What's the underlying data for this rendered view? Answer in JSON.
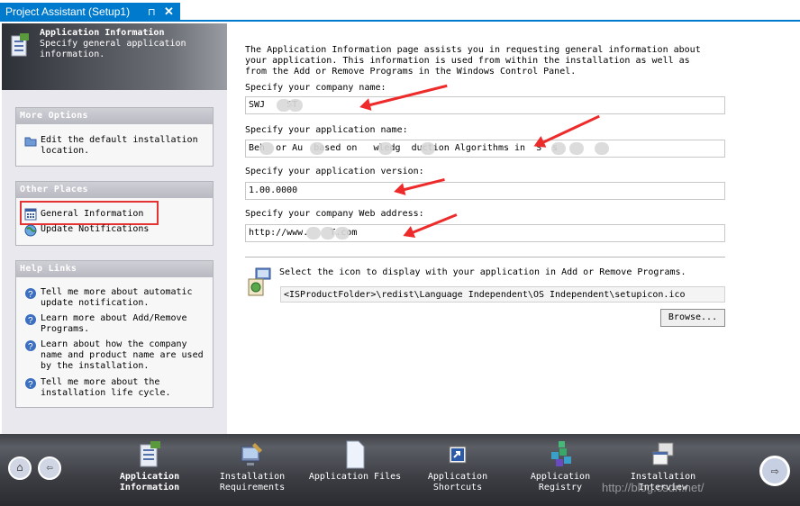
{
  "tab": {
    "title": "Project Assistant (Setup1)",
    "pin": "⊓",
    "close": "✕"
  },
  "header": {
    "title": "Application Information",
    "subtitle": "Specify general application information."
  },
  "more_options": {
    "title": "More Options",
    "items": [
      {
        "label": "Edit the default installation location.",
        "icon": "folder-icon"
      }
    ]
  },
  "other_places": {
    "title": "Other Places",
    "items": [
      {
        "label": "General Information",
        "icon": "grid-icon"
      },
      {
        "label": "Update Notifications",
        "icon": "globe-icon"
      }
    ]
  },
  "help_links": {
    "title": "Help Links",
    "items": [
      {
        "label": "Tell me more about automatic update notification."
      },
      {
        "label": "Learn more about Add/Remove Programs."
      },
      {
        "label": "Learn about how the company name and product name are used by the installation."
      },
      {
        "label": "Tell me more about the installation life cycle."
      }
    ]
  },
  "main": {
    "intro": "The Application Information page assists you in requesting general information about\nyour application. This information is used from within the installation as well as\nfrom the Add or Remove Programs in the Windows Control Panel.",
    "company_label": "Specify your company name:",
    "company_value": "SWJ    ST",
    "appname_label": "Specify your application name:",
    "appname_value": "Beh  or Au  based on   wledg  duction Algorithms in  S  s",
    "version_label": "Specify your application version:",
    "version_value": "1.00.0000",
    "web_label": "Specify your company Web address:",
    "web_value": "http://www.    T.com",
    "icon_label": "Select the icon to display with your application in Add or Remove Programs.",
    "icon_path": "<ISProductFolder>\\redist\\Language Independent\\OS Independent\\setupicon.ico",
    "browse_label": "Browse..."
  },
  "bottom": {
    "items": [
      {
        "label": "Application Information",
        "active": true
      },
      {
        "label": "Installation Requirements"
      },
      {
        "label": "Application Files"
      },
      {
        "label": "Application Shortcuts"
      },
      {
        "label": "Application Registry"
      },
      {
        "label": "Installation Interview"
      }
    ],
    "home": "⌂",
    "back": "⇦",
    "next": "⇨",
    "watermark": "http://blog.csdn.net/"
  },
  "colors": {
    "accent": "#007acc",
    "arrow": "#ee2b2b",
    "highlight_box": "#e53232"
  }
}
